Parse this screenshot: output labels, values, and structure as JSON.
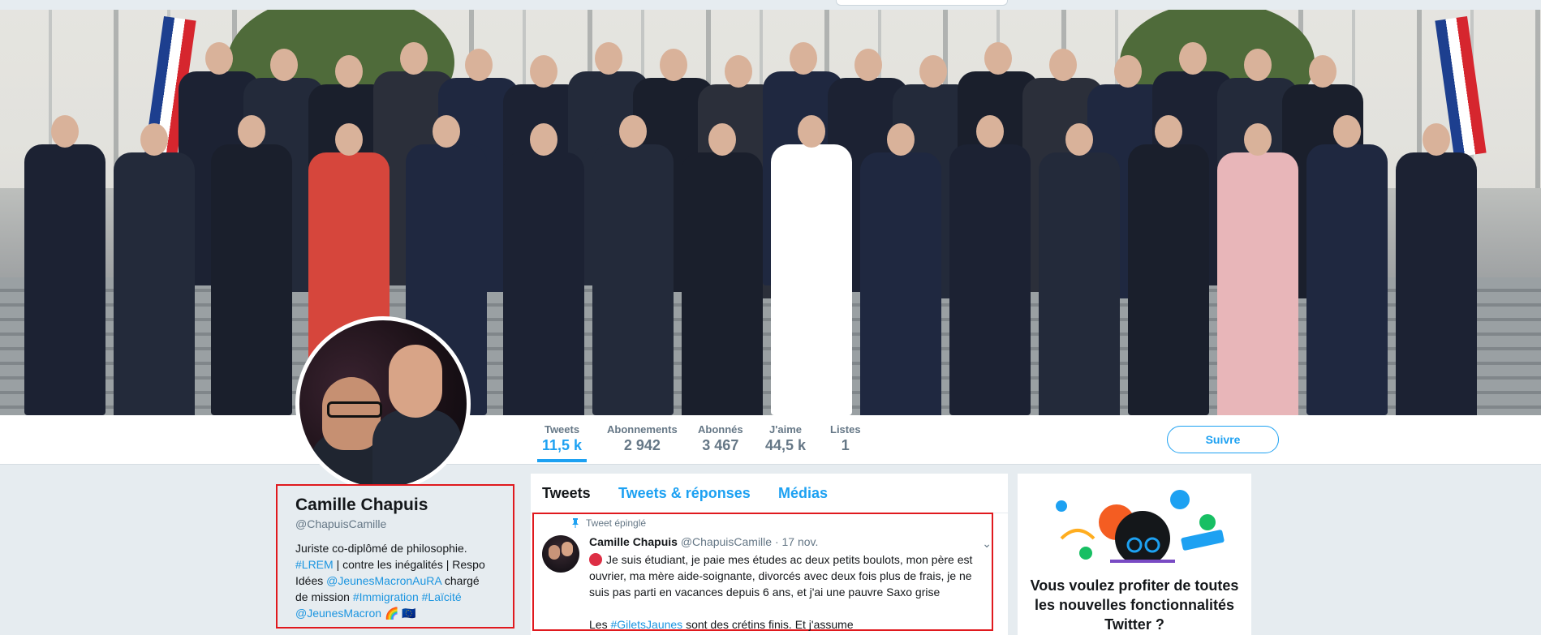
{
  "profile": {
    "name": "Camille Chapuis",
    "handle": "@ChapuisCamille",
    "bio": {
      "line1": "Juriste co-diplômé de philosophie.",
      "hashtag_lrem": "#LREM",
      "line2_rest": " | contre les inégalités | Respo Idées ",
      "mention_jma": "@JeunesMacronAuRA",
      "line3_rest": " chargé de mission ",
      "hashtag_immigration": "#Immigration",
      "hashtag_laicite": "#Laïcité",
      "mention_jm": "@JeunesMacron",
      "emojis": "🌈 🇪🇺"
    }
  },
  "stats": [
    {
      "label": "Tweets",
      "value": "11,5 k"
    },
    {
      "label": "Abonnements",
      "value": "2 942"
    },
    {
      "label": "Abonnés",
      "value": "3 467"
    },
    {
      "label": "J'aime",
      "value": "44,5 k"
    },
    {
      "label": "Listes",
      "value": "1"
    }
  ],
  "follow_label": "Suivre",
  "tabs": [
    "Tweets",
    "Tweets & réponses",
    "Médias"
  ],
  "tweet": {
    "pinned_label": "Tweet épinglé",
    "author_name": "Camille Chapuis",
    "author_handle": "@ChapuisCamille",
    "date": "· 17 nov.",
    "text1": "Je suis étudiant, je paie mes études ac deux petits boulots, mon père est ouvrier, ma mère aide-soignante, divorcés avec deux fois plus de frais, je ne suis pas parti en vacances depuis 6 ans, et j'ai une pauvre Saxo grise",
    "text2_prefix": "Les ",
    "hashtag": "#GiletsJaunes",
    "text2_suffix": " sont des crétins finis. Et j'assume"
  },
  "promo": {
    "title": "Vous voulez profiter de toutes les nouvelles fonctionnalités Twitter ?"
  },
  "colors": {
    "accent": "#1da1f2",
    "highlight_border": "#e0191e",
    "background": "#e6ecf0"
  },
  "icons": [
    "pin-icon",
    "chevron-down-icon",
    "red-circle-emoji"
  ]
}
